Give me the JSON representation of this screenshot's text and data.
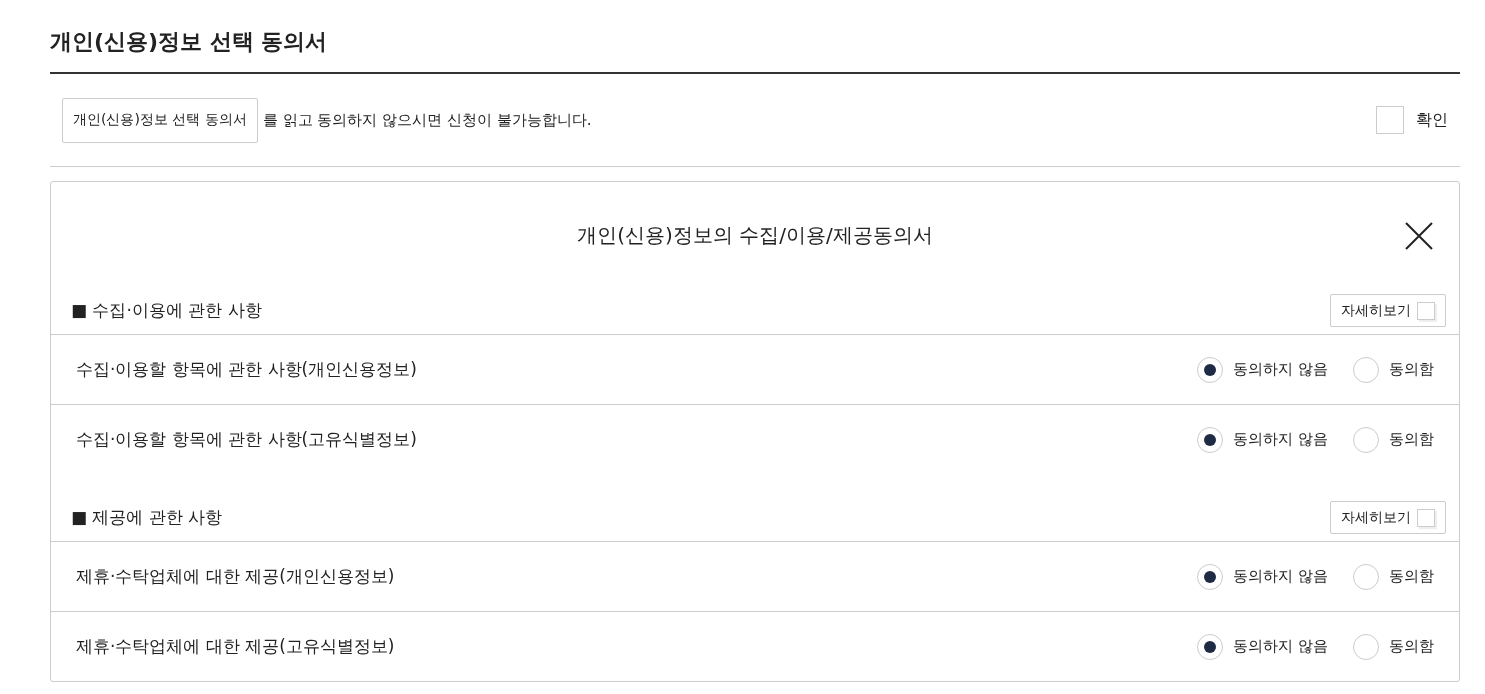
{
  "title": "개인(신용)정보 선택 동의서",
  "notice": {
    "button": "개인(신용)정보 선택 동의서",
    "text": "를 읽고 동의하지 않으시면 신청이 불가능합니다.",
    "confirm_label": "확인",
    "confirm_checked": false
  },
  "panel": {
    "title": "개인(신용)정보의 수집/이용/제공동의서",
    "sections": [
      {
        "heading": "■ 수집·이용에 관한 사항",
        "detail_button": "자세히보기",
        "rows": [
          {
            "label": "수집·이용할 항목에 관한 사항(개인신용정보)",
            "options": [
              {
                "label": "동의하지 않음",
                "selected": true
              },
              {
                "label": "동의함",
                "selected": false
              }
            ]
          },
          {
            "label": "수집·이용할 항목에 관한 사항(고유식별정보)",
            "options": [
              {
                "label": "동의하지 않음",
                "selected": true
              },
              {
                "label": "동의함",
                "selected": false
              }
            ]
          }
        ]
      },
      {
        "heading": "■ 제공에 관한 사항",
        "detail_button": "자세히보기",
        "rows": [
          {
            "label": "제휴·수탁업체에 대한 제공(개인신용정보)",
            "options": [
              {
                "label": "동의하지 않음",
                "selected": true
              },
              {
                "label": "동의함",
                "selected": false
              }
            ]
          },
          {
            "label": "제휴·수탁업체에 대한 제공(고유식별정보)",
            "options": [
              {
                "label": "동의하지 않음",
                "selected": true
              },
              {
                "label": "동의함",
                "selected": false
              }
            ]
          }
        ]
      }
    ]
  }
}
